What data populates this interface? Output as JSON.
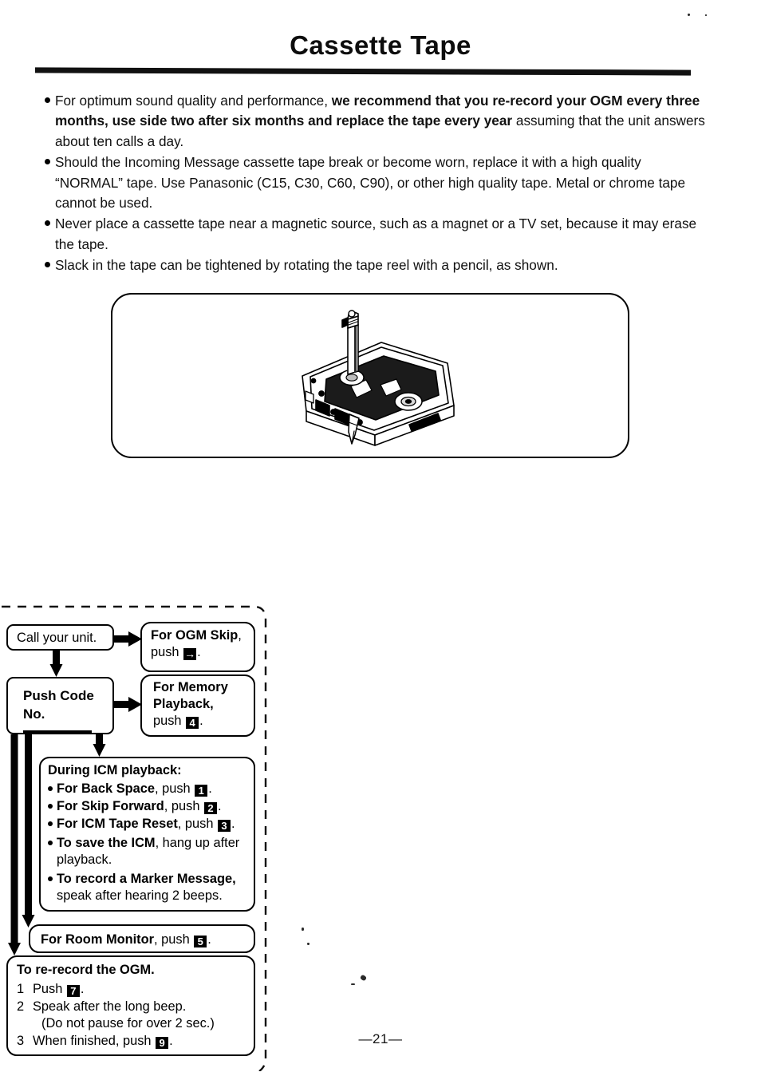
{
  "page": {
    "title": "Cassette Tape",
    "page_number": "—21—"
  },
  "bullets": [
    {
      "id": "bullet-re-record-schedule",
      "segments": [
        {
          "text": "For optimum sound quality and performance, ",
          "bold": false
        },
        {
          "text": "we recommend that you re-record your OGM every three months, use side two after six months and replace the tape every year",
          "bold": true
        },
        {
          "text": " assuming that the unit answers about ten calls a day.",
          "bold": false
        }
      ]
    },
    {
      "id": "bullet-tape-replacement",
      "segments": [
        {
          "text": "Should the Incoming Message cassette tape break or become worn, replace it with a high quality “NORMAL” tape. Use Panasonic (C15, C30, C60, C90), or other high quality tape. Metal or chrome tape cannot be used.",
          "bold": false
        }
      ]
    },
    {
      "id": "bullet-magnetic-source",
      "segments": [
        {
          "text": "Never place a cassette tape near a magnetic source, such as a magnet or a TV set, because it may erase the tape.",
          "bold": false
        }
      ]
    },
    {
      "id": "bullet-slack-pencil",
      "segments": [
        {
          "text": "Slack in the tape can be tightened by rotating the tape reel with a pencil, as shown.",
          "bold": false
        }
      ]
    }
  ],
  "illustration": {
    "name": "cassette-tape-with-pencil-illustration",
    "description": "Cassette tape shown in isometric view with a pencil inserted into the tape reel hub to take up slack"
  },
  "flowchart": {
    "call_unit": {
      "label": "Call your unit."
    },
    "push_code": {
      "line1": "Push Code",
      "line2": "No."
    },
    "ogm_skip": {
      "line1_bold": "For OGM Skip",
      "line1_rest": ",",
      "push_word": "push",
      "key": "→",
      "period": "."
    },
    "memory_playback": {
      "line1_bold": "For Memory",
      "line2_bold": "Playback,",
      "push_word": "push",
      "key": "4",
      "period": "."
    },
    "icm_playback": {
      "heading": "During ICM playback:",
      "items": [
        {
          "bold": "For Back Space",
          "rest": ", push",
          "key": "1",
          "tail": "."
        },
        {
          "bold": "For Skip Forward",
          "rest": ", push",
          "key": "2",
          "tail": "."
        },
        {
          "bold": "For ICM Tape Reset",
          "rest": ", push",
          "key": "3",
          "tail": "."
        },
        {
          "bold": "To save the ICM",
          "rest": ", hang up after playback.",
          "key": "",
          "tail": ""
        },
        {
          "bold": "To record a Marker Message,",
          "rest": " speak after hearing 2 beeps.",
          "key": "",
          "tail": ""
        }
      ]
    },
    "room_monitor": {
      "bold": "For Room Monitor",
      "rest": ", push",
      "key": "5",
      "tail": "."
    },
    "re_record_ogm": {
      "heading": "To re-record the OGM.",
      "steps": [
        {
          "num": "1",
          "text_before": "Push",
          "key": "7",
          "text_after": ".",
          "sub": ""
        },
        {
          "num": "2",
          "text_before": "Speak after the long beep.",
          "key": "",
          "text_after": "",
          "sub": "(Do not pause for over 2 sec.)"
        },
        {
          "num": "3",
          "text_before": "When finished, push",
          "key": "9",
          "text_after": ".",
          "sub": ""
        }
      ]
    }
  },
  "colors": {
    "ink": "#000000",
    "paper": "#ffffff"
  }
}
